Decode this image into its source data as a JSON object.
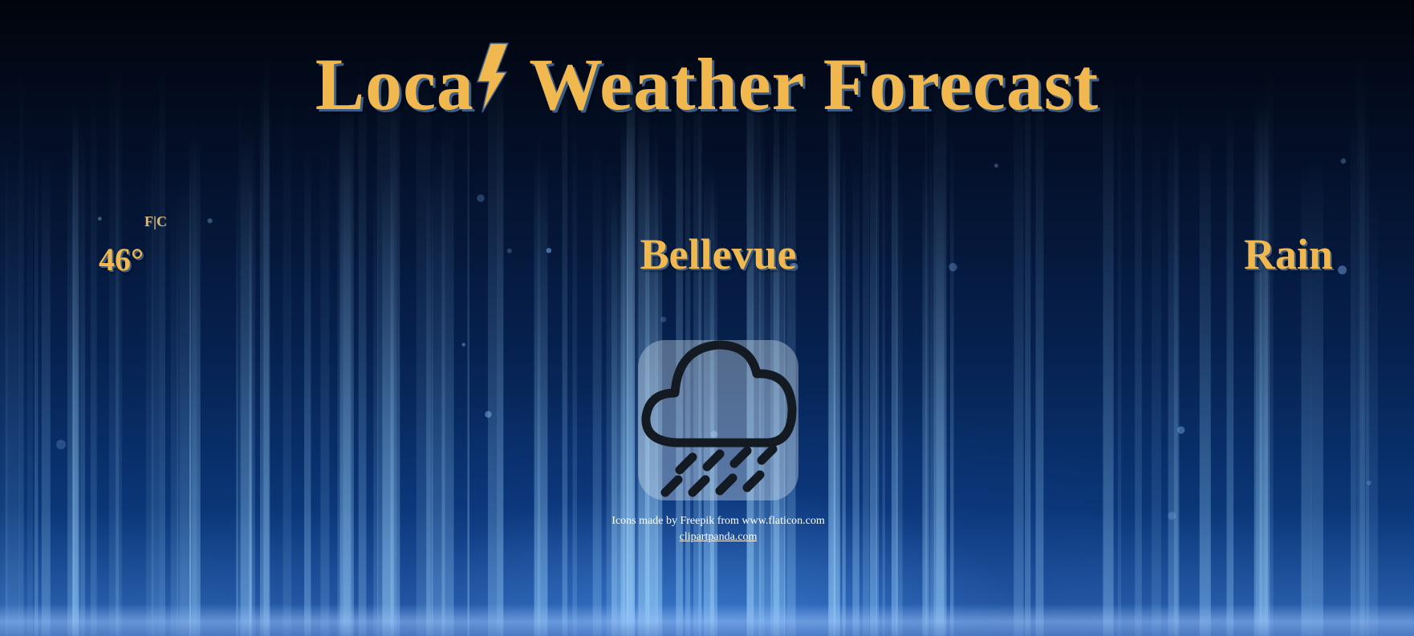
{
  "header": {
    "title_before": "Loca",
    "title_after": " Weather Forecast"
  },
  "weather": {
    "temperature": "46°",
    "unit_toggle": "F|C",
    "city": "Bellevue",
    "condition": "Rain",
    "icon": "rain-cloud-icon"
  },
  "credits": {
    "line1": "Icons made by Freepik from www.flaticon.com",
    "link": "clipartpanda.com"
  },
  "colors": {
    "title": "#f1b84f",
    "background": "#06214f",
    "icon_stroke": "#141a22"
  }
}
